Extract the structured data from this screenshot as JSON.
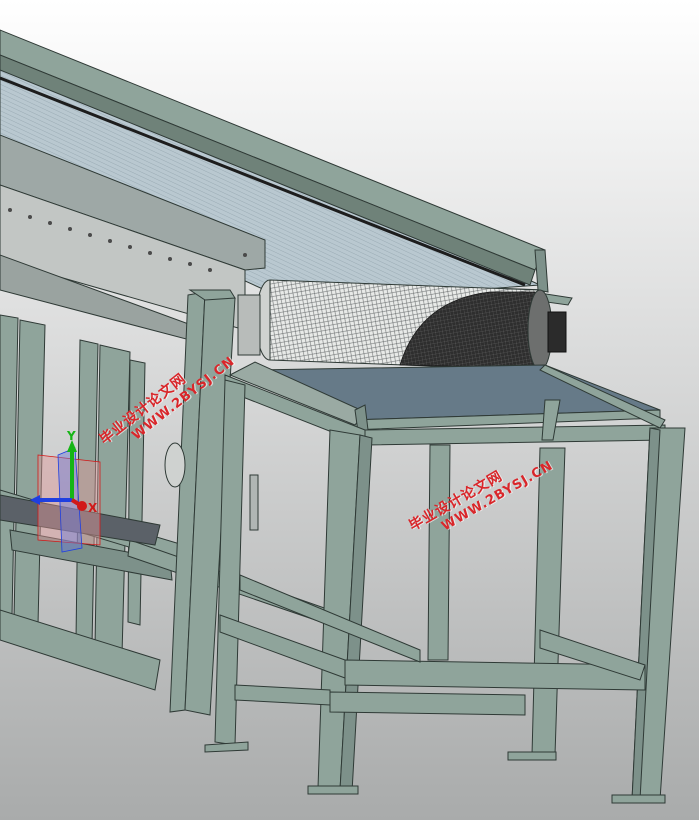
{
  "viewport": {
    "background_top": "#ffffff",
    "background_bottom": "#a9abab",
    "frame_color": "#8fa49b",
    "frame_edge": "#2f3a36",
    "belt_color": "#b9c8d0",
    "roller_dark": "#3a3a3a",
    "plate_color": "#667a88"
  },
  "triad": {
    "x_label": "X",
    "y_label": "Y",
    "x_color": "#d11919",
    "y_color": "#15b515",
    "z_color": "#1f3fe0"
  },
  "watermarks": [
    {
      "cn": "毕业设计论文网",
      "url": "WWW.2BYSJ.CN"
    },
    {
      "cn": "毕业设计论文网",
      "url": "WWW.2BYSJ.CN"
    }
  ]
}
